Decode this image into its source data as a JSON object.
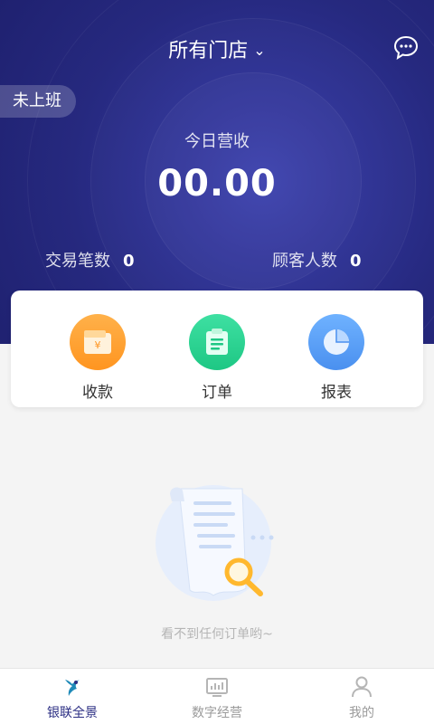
{
  "header": {
    "store_selector": "所有门店",
    "shift_status": "未上班",
    "revenue_label": "今日营收",
    "revenue_value": "00.00",
    "transactions_label": "交易笔数",
    "transactions_value": "0",
    "customers_label": "顾客人数",
    "customers_value": "0"
  },
  "actions": [
    {
      "label": "收款",
      "icon": "wallet-icon",
      "color": "#ff9f2e"
    },
    {
      "label": "订单",
      "icon": "clipboard-icon",
      "color": "#27d08e"
    },
    {
      "label": "报表",
      "icon": "pie-chart-icon",
      "color": "#5a9df5"
    }
  ],
  "empty_state": {
    "message": "看不到任何订单哟~",
    "icon": "empty-receipt-search-icon"
  },
  "tabbar": {
    "items": [
      {
        "label": "银联全景",
        "icon": "unionpay-logo-icon",
        "active": true
      },
      {
        "label": "数字经营",
        "icon": "analytics-icon",
        "active": false
      },
      {
        "label": "我的",
        "icon": "user-icon",
        "active": false
      }
    ]
  },
  "colors": {
    "header_bg": "#26297f",
    "accent": "#2b2e83"
  }
}
